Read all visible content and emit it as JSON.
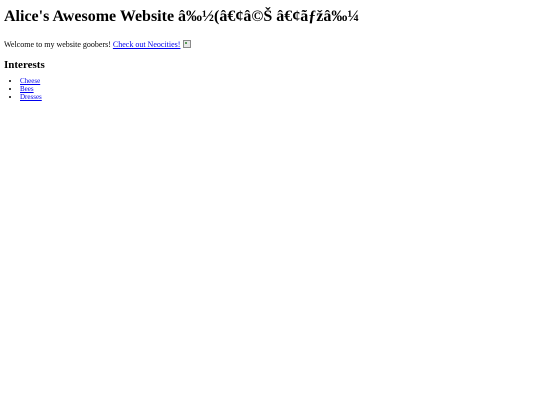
{
  "page": {
    "title": "Alice's Awesome Website â‰½(â€¢â©Š â€¢ãƒžâ‰¼",
    "intro_text": "Welcome to my website goobers!",
    "link_text": "Check out Neocities!",
    "image_icon": "broken-image-icon",
    "link_color": "#0000ee"
  },
  "interests": {
    "heading": "Interests",
    "items": [
      "Cheese",
      "Bees",
      "Dresses"
    ]
  }
}
